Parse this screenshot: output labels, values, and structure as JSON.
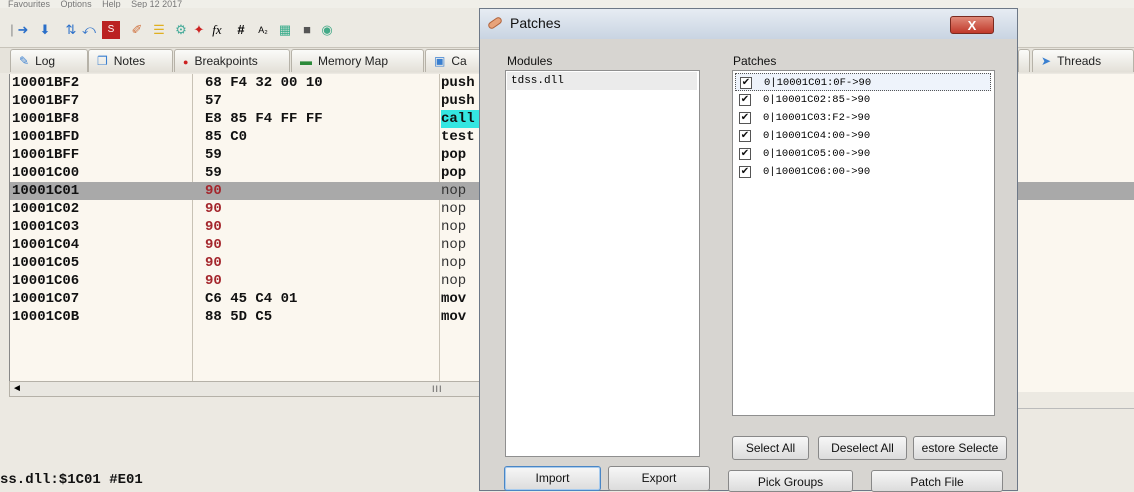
{
  "menubar": {
    "items": [
      "Favourites",
      "Options",
      "Help",
      "Sep 12 2017"
    ]
  },
  "toolbar": {
    "icons": [
      "arrow-right-icon",
      "arrow-down-icon",
      "run-to-user-icon",
      "goto-icon",
      "trace-icon",
      "patch-icon",
      "comment-icon",
      "label-icon",
      "bookmark-icon",
      "function-icon",
      "hash-icon",
      "font-icon",
      "highlight-icon",
      "calculator-icon",
      "settings-icon"
    ],
    "fx_label": "fx",
    "hash_label": "#",
    "font_label": "A₂"
  },
  "tabs": [
    {
      "label": "Log",
      "icon": "log-icon"
    },
    {
      "label": "Notes",
      "icon": "notes-icon"
    },
    {
      "label": "Breakpoints",
      "icon": "breakpoint-dot-icon"
    },
    {
      "label": "Memory Map",
      "icon": "memory-map-icon"
    },
    {
      "label": "Ca",
      "icon": "call-stack-icon"
    },
    {
      "label": "Threads",
      "icon": "threads-icon"
    }
  ],
  "disasm": {
    "rows": [
      {
        "addr": "10001BF2",
        "bytes": "68 F4 32 00 10",
        "mnemonic": "push",
        "kind": "normal"
      },
      {
        "addr": "10001BF7",
        "bytes": "57",
        "mnemonic": "push",
        "kind": "normal"
      },
      {
        "addr": "10001BF8",
        "bytes": "E8 85 F4 FF FF",
        "mnemonic": "call",
        "kind": "call"
      },
      {
        "addr": "10001BFD",
        "bytes": "85 C0",
        "mnemonic": "test",
        "kind": "normal"
      },
      {
        "addr": "10001BFF",
        "bytes": "59",
        "mnemonic": "pop",
        "kind": "normal"
      },
      {
        "addr": "10001C00",
        "bytes": "59",
        "mnemonic": "pop",
        "kind": "normal"
      },
      {
        "addr": "10001C01",
        "bytes": "90",
        "mnemonic": "nop",
        "kind": "selected"
      },
      {
        "addr": "10001C02",
        "bytes": "90",
        "mnemonic": "nop",
        "kind": "patched"
      },
      {
        "addr": "10001C03",
        "bytes": "90",
        "mnemonic": "nop",
        "kind": "patched"
      },
      {
        "addr": "10001C04",
        "bytes": "90",
        "mnemonic": "nop",
        "kind": "patched"
      },
      {
        "addr": "10001C05",
        "bytes": "90",
        "mnemonic": "nop",
        "kind": "patched"
      },
      {
        "addr": "10001C06",
        "bytes": "90",
        "mnemonic": "nop",
        "kind": "patched"
      },
      {
        "addr": "10001C07",
        "bytes": "C6 45 C4 01",
        "mnemonic": "mov",
        "kind": "normal"
      },
      {
        "addr": "10001C0B",
        "bytes": "88 5D C5",
        "mnemonic": "mov",
        "kind": "normal"
      }
    ]
  },
  "hscroll": {
    "left_arrow": "◄",
    "grip": "III"
  },
  "status": {
    "text": "ss.dll:$1C01 #E01"
  },
  "dialog": {
    "title": "Patches",
    "close_label": "X",
    "modules_label": "Modules",
    "patches_label": "Patches",
    "modules": [
      "tdss.dll"
    ],
    "patches": [
      {
        "text": "0|10001C01:0F->90",
        "checked": true
      },
      {
        "text": "0|10001C02:85->90",
        "checked": true
      },
      {
        "text": "0|10001C03:F2->90",
        "checked": true
      },
      {
        "text": "0|10001C04:00->90",
        "checked": true
      },
      {
        "text": "0|10001C05:00->90",
        "checked": true
      },
      {
        "text": "0|10001C06:00->90",
        "checked": true
      }
    ],
    "buttons": {
      "select_all": "Select All",
      "deselect_all": "Deselect All",
      "restore_selected": "estore Selecte",
      "import": "Import",
      "export": "Export",
      "pick_groups": "Pick Groups",
      "patch_file": "Patch File"
    }
  }
}
